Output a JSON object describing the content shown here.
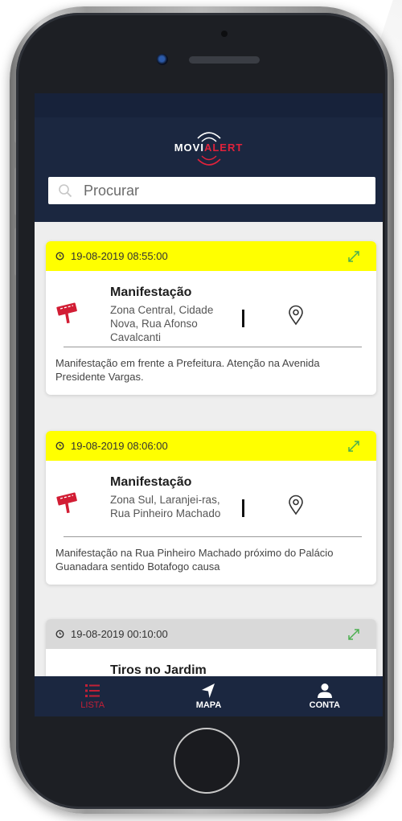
{
  "app": {
    "logo_prefix": "MOVI",
    "logo_suffix": "ALERT"
  },
  "search": {
    "placeholder": "Procurar"
  },
  "alerts": [
    {
      "datetime": "19-08-2019  08:55:00",
      "title": "Manifestação",
      "address": "Zona Central, Cidade Nova, Rua Afonso Cavalcanti",
      "description": "Manifestação em frente a Prefeitura. Atenção na Avenida Presidente Vargas.",
      "header_color": "#ffff00",
      "icon": "protest-sign-icon"
    },
    {
      "datetime": "19-08-2019  08:06:00",
      "title": "Manifestação",
      "address": "Zona Sul, Laranjei-ras, Rua Pinheiro Machado",
      "description": "Manifestação na Rua Pinheiro Machado próximo do Palácio Guanadara sentido Botafogo causa",
      "header_color": "#ffff00",
      "icon": "protest-sign-icon"
    },
    {
      "datetime": "19-08-2019  00:10:00",
      "title": "Tiros no Jardim",
      "header_color": "#d9d9d9"
    }
  ],
  "nav": {
    "items": [
      {
        "label": "LISTA",
        "icon": "list-icon",
        "active": true
      },
      {
        "label": "MAPA",
        "icon": "navigation-arrow-icon",
        "active": false
      },
      {
        "label": "CONTA",
        "icon": "user-icon",
        "active": false
      }
    ]
  },
  "colors": {
    "header_bg": "#1b2740",
    "brand_red": "#e0223b",
    "active_nav": "#c32036",
    "highlight_yellow": "#ffff00"
  }
}
